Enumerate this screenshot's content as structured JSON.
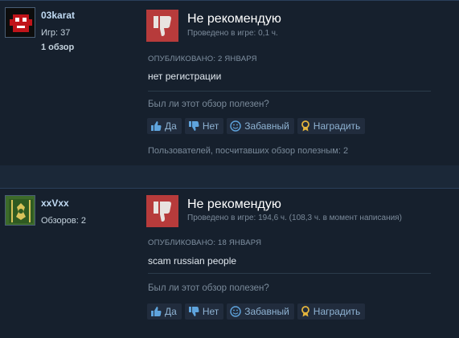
{
  "reviews": [
    {
      "username": "03karat",
      "stat_line": "Игр: 37",
      "reviews_line": "1 обзор",
      "verdict": "Не рекомендую",
      "hours": "Проведено в игре: 0,1 ч.",
      "posted": "ОПУБЛИКОВАНО: 2 ЯНВАРЯ",
      "text": "нет регистрации",
      "question": "Был ли этот обзор полезен?",
      "buttons": {
        "yes": "Да",
        "no": "Нет",
        "funny": "Забавный",
        "award": "Наградить"
      },
      "helpful_count": "Пользователей, посчитавших обзор полезным: 2"
    },
    {
      "username": "xxVxx",
      "stat_line": "Обзоров: 2",
      "verdict": "Не рекомендую",
      "hours": "Проведено в игре: 194,6 ч. (108,3 ч. в момент написания)",
      "posted": "ОПУБЛИКОВАНО: 18 ЯНВАРЯ",
      "text": "scam russian people",
      "question": "Был ли этот обзор полезен?",
      "buttons": {
        "yes": "Да",
        "no": "Нет",
        "funny": "Забавный",
        "award": "Наградить"
      }
    }
  ],
  "icons": {
    "verdict": "thumbs-down-icon",
    "yes": "thumbs-up-icon",
    "no": "thumbs-down-icon",
    "funny": "smiley-icon",
    "award": "award-icon"
  },
  "colors": {
    "background": "#1b2838",
    "panel": "#16202d",
    "verdict_box": "#b73b3b",
    "username": "#c1dbf4",
    "button_text": "#8fb3d3"
  }
}
